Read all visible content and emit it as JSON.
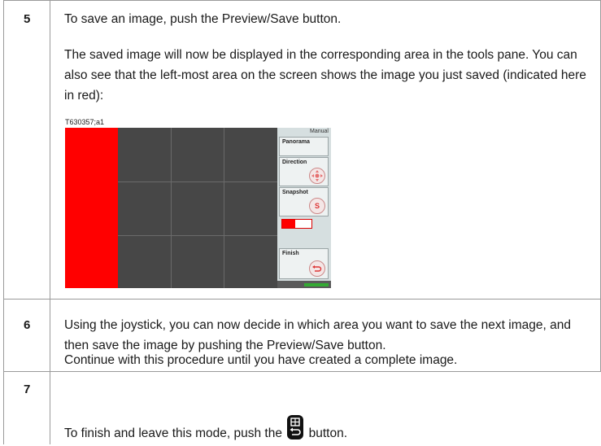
{
  "steps": [
    {
      "number": "5",
      "paragraphs": [
        "To save an image, push the Preview/Save button.",
        "The saved image will now be displayed in the corresponding area in the tools pane. You can also see that the left-most area on the screen shows the image you just saved (indicated here in red):"
      ],
      "figure": {
        "caption": "T630357;a1",
        "tools_pane": {
          "header": "Manual",
          "title": "Panorama",
          "direction_label": "Direction",
          "snapshot_label": "Snapshot",
          "snapshot_button": "S",
          "finish_label": "Finish",
          "progress": 0.45,
          "highlight_color": "#ff0000"
        }
      }
    },
    {
      "number": "6",
      "paragraphs": [
        "Using the joystick, you can now decide in which area you want to save the next image, and then save the image by pushing the Preview/Save button.",
        "Continue with this procedure until you have created a complete image."
      ]
    },
    {
      "number": "7",
      "text_before": "To finish and leave this mode, push the",
      "icon": "back-grid-button-icon",
      "text_after": "button."
    }
  ]
}
